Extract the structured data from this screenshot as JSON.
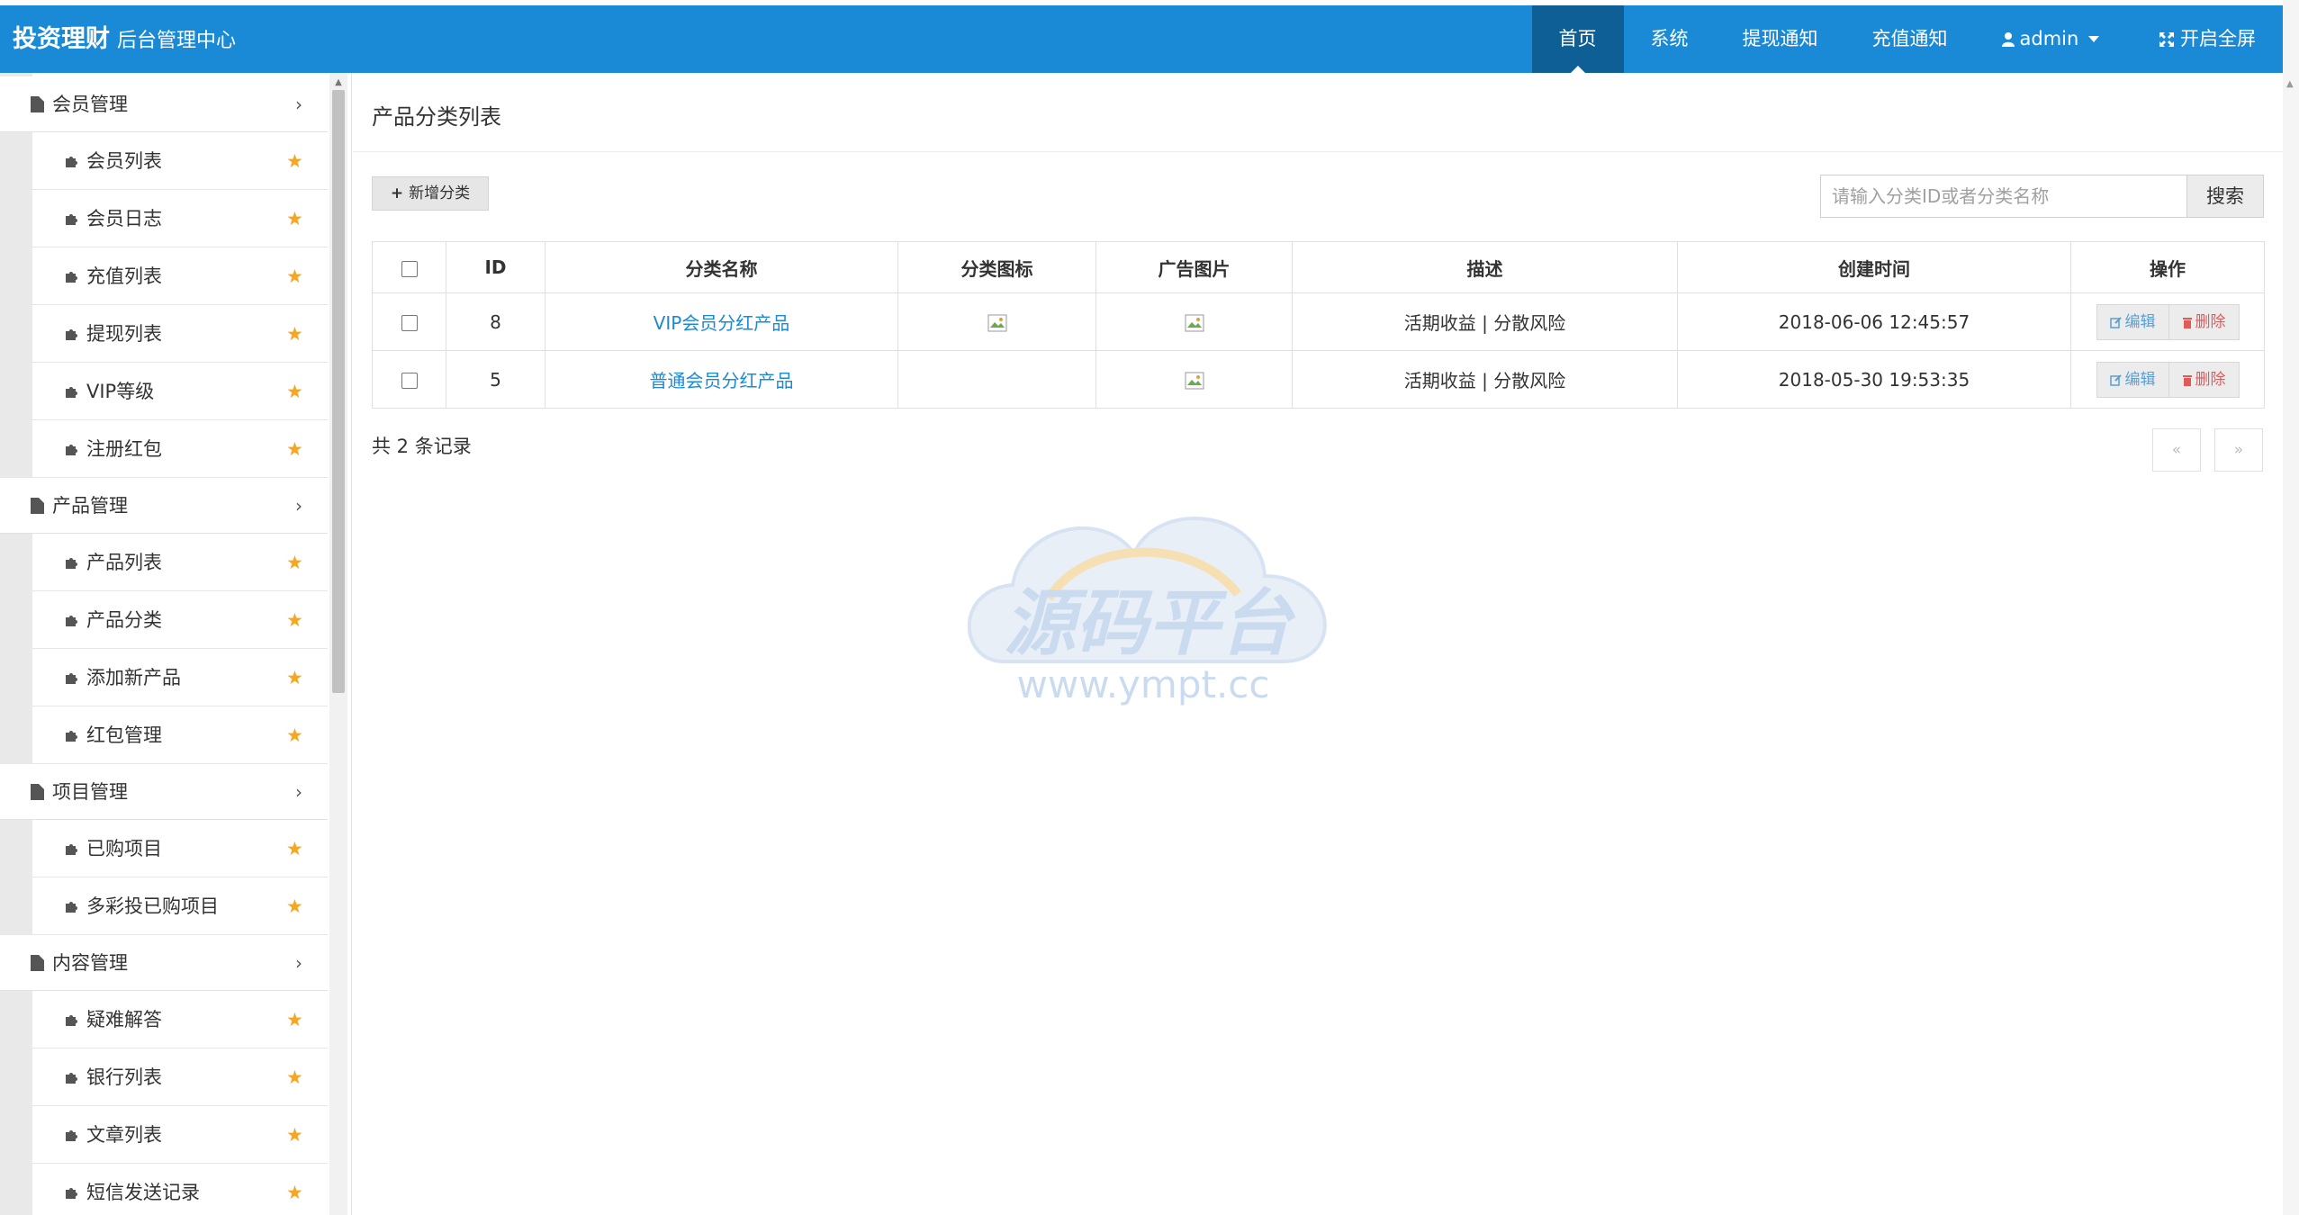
{
  "header": {
    "brand_main": "投资理财",
    "brand_sub": "后台管理中心",
    "nav": [
      "首页",
      "系统",
      "提现通知",
      "充值通知"
    ],
    "user": "admin",
    "fullscreen": "开启全屏"
  },
  "sidebar": {
    "groups": [
      {
        "label": "会员管理",
        "items": [
          "会员列表",
          "会员日志",
          "充值列表",
          "提现列表",
          "VIP等级",
          "注册红包"
        ]
      },
      {
        "label": "产品管理",
        "items": [
          "产品列表",
          "产品分类",
          "添加新产品",
          "红包管理"
        ]
      },
      {
        "label": "项目管理",
        "items": [
          "已购项目",
          "多彩投已购项目"
        ]
      },
      {
        "label": "内容管理",
        "items": [
          "疑难解答",
          "银行列表",
          "文章列表",
          "短信发送记录"
        ]
      }
    ]
  },
  "main": {
    "title": "产品分类列表",
    "add_button": "新增分类",
    "search_placeholder": "请输入分类ID或者分类名称",
    "search_button": "搜索",
    "columns": [
      "ID",
      "分类名称",
      "分类图标",
      "广告图片",
      "描述",
      "创建时间",
      "操作"
    ],
    "rows": [
      {
        "id": "8",
        "name": "VIP会员分红产品",
        "desc": "活期收益 | 分散风险",
        "created": "2018-06-06 12:45:57"
      },
      {
        "id": "5",
        "name": "普通会员分红产品",
        "desc": "活期收益 | 分散风险",
        "created": "2018-05-30 19:53:35"
      }
    ],
    "edit_label": "编辑",
    "delete_label": "删除",
    "count_text": "共 2 条记录",
    "prev": "«",
    "next": "»"
  },
  "watermark": {
    "title": "源码平台",
    "url": "www.ympt.cc"
  },
  "colors": {
    "header_bg": "#1a8ad6",
    "nav_active_bg": "#0f5f97",
    "link": "#1a8ad6",
    "star": "#f5a623",
    "delete": "#e05a5a"
  }
}
